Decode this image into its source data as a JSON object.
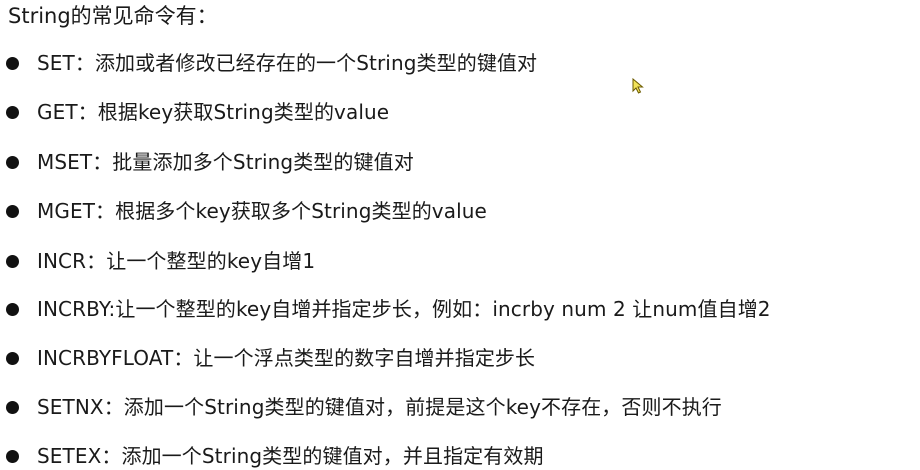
{
  "heading": "String的常见命令有：",
  "commands": [
    "SET：添加或者修改已经存在的一个String类型的键值对",
    "GET：根据key获取String类型的value",
    "MSET：批量添加多个String类型的键值对",
    "MGET：根据多个key获取多个String类型的value",
    "INCR：让一个整型的key自增1",
    "INCRBY:让一个整型的key自增并指定步长，例如：incrby num 2 让num值自增2",
    "INCRBYFLOAT：让一个浮点类型的数字自增并指定步长",
    "SETNX：添加一个String类型的键值对，前提是这个key不存在，否则不执行",
    "SETEX：添加一个String类型的键值对，并且指定有效期"
  ],
  "icons": {
    "bullet": "bullet-dot-icon",
    "cursor": "mouse-pointer-icon"
  }
}
